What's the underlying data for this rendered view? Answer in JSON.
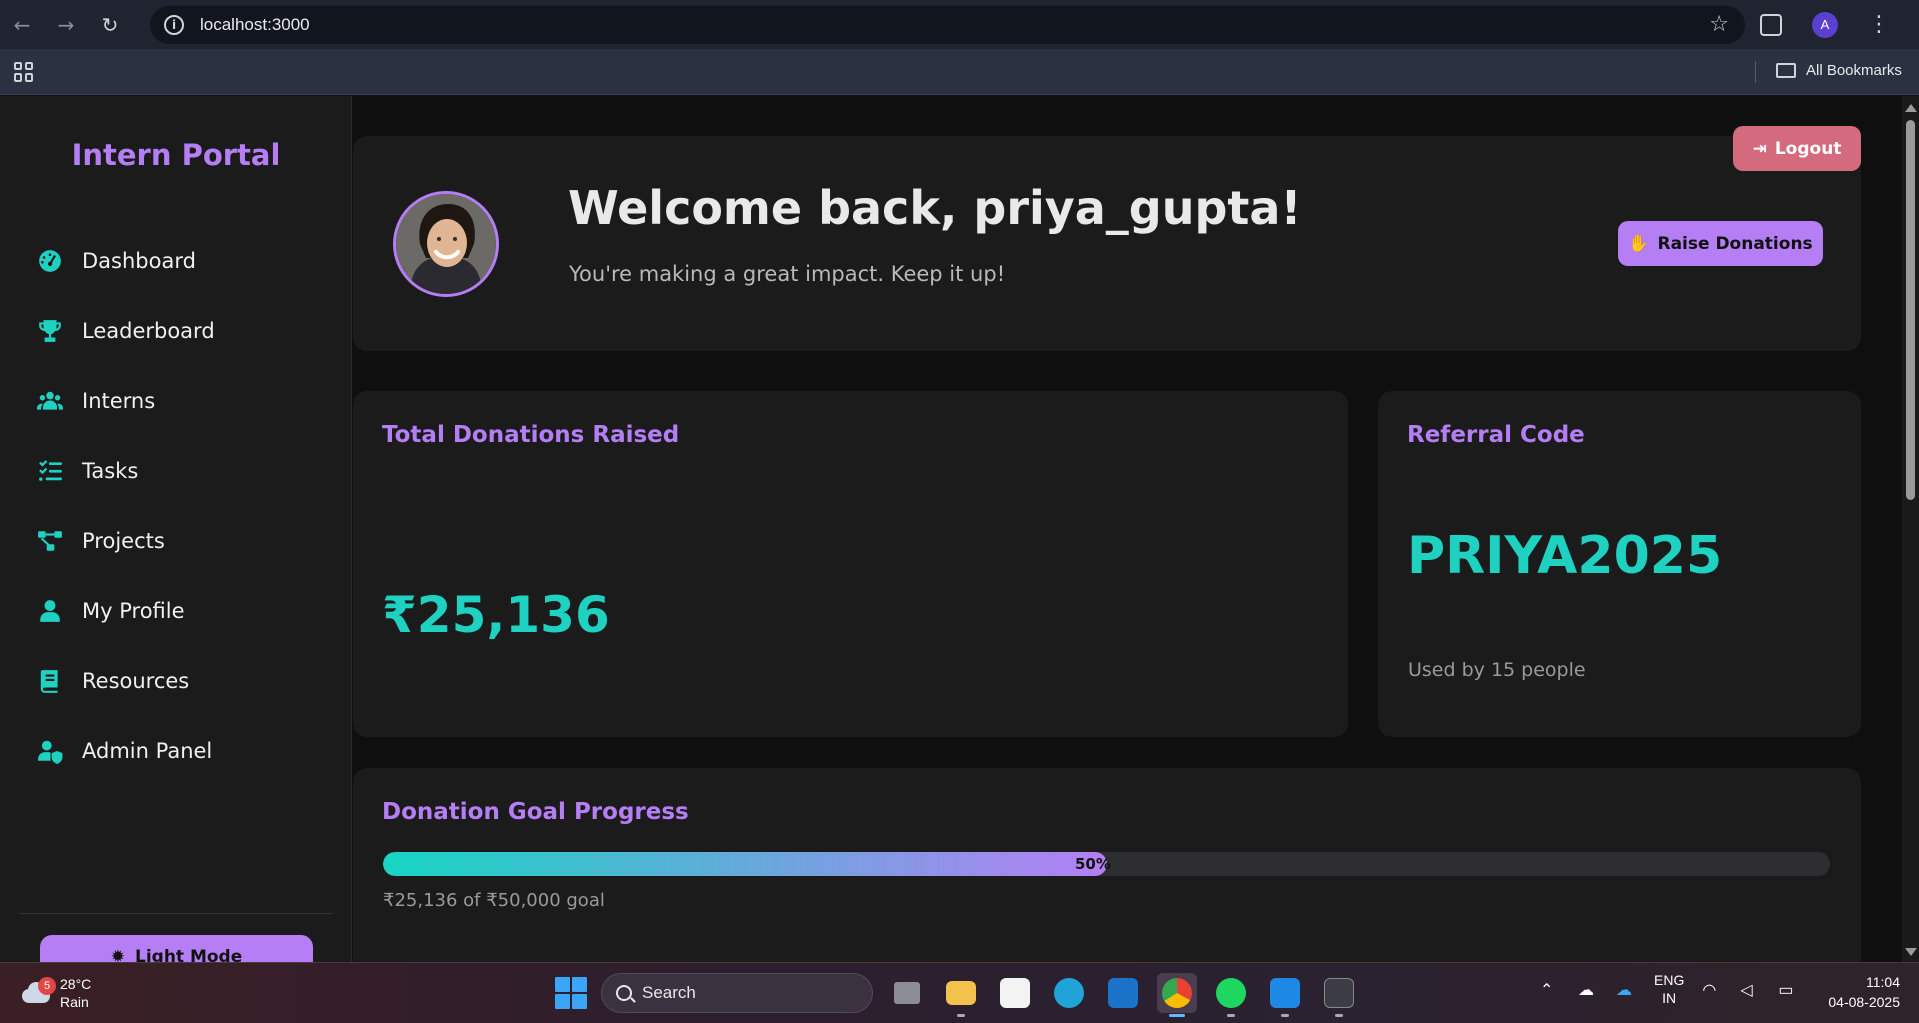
{
  "browser": {
    "url": "localhost:3000",
    "profile_initial": "A",
    "all_bookmarks_label": "All Bookmarks"
  },
  "sidebar": {
    "brand": "Intern Portal",
    "items": [
      {
        "label": "Dashboard",
        "icon": "gauge-icon"
      },
      {
        "label": "Leaderboard",
        "icon": "trophy-icon"
      },
      {
        "label": "Interns",
        "icon": "users-icon"
      },
      {
        "label": "Tasks",
        "icon": "checklist-icon"
      },
      {
        "label": "Projects",
        "icon": "diagram-icon"
      },
      {
        "label": "My Profile",
        "icon": "user-icon"
      },
      {
        "label": "Resources",
        "icon": "book-icon"
      },
      {
        "label": "Admin Panel",
        "icon": "user-shield-icon"
      }
    ],
    "light_mode_label": "Light Mode"
  },
  "header": {
    "logout_label": "Logout",
    "welcome_title": "Welcome back, priya_gupta!",
    "welcome_subtitle": "You're making a great impact. Keep it up!",
    "raise_donations_label": "Raise Donations"
  },
  "donations": {
    "title": "Total Donations Raised",
    "value": "₹25,136"
  },
  "referral": {
    "title": "Referral Code",
    "code": "PRIYA2025",
    "used_text": "Used by 15 people"
  },
  "goal": {
    "title": "Donation Goal Progress",
    "percent": 50,
    "percent_label": "50%",
    "goal_text": "₹25,136 of ₹50,000 goal"
  },
  "colors": {
    "accent_purple": "#b57ef5",
    "accent_teal": "#1fd1c1",
    "logout_red": "#d46a7e"
  },
  "taskbar": {
    "weather_temp": "28°C",
    "weather_desc": "Rain",
    "weather_badge": "5",
    "search_label": "Search",
    "lang_line1": "ENG",
    "lang_line2": "IN",
    "time": "11:04",
    "date": "04-08-2025"
  }
}
